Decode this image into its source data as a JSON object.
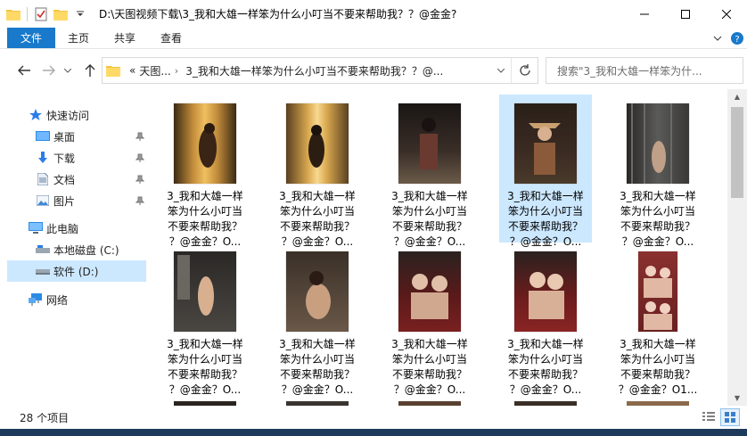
{
  "window": {
    "title": "D:\\天图视频下载\\3_我和大雄一样笨为什么小叮当不要来帮助我？？@金金?",
    "controls": {
      "minimize": "minimize",
      "maximize": "maximize",
      "close": "close"
    }
  },
  "ribbon": {
    "tabs": [
      {
        "label": "文件",
        "active": true
      },
      {
        "label": "主页"
      },
      {
        "label": "共享"
      },
      {
        "label": "查看"
      }
    ]
  },
  "address": {
    "overflow": "«",
    "parts": [
      "天图...",
      "3_我和大雄一样笨为什么小叮当不要来帮助我？？@..."
    ],
    "search_placeholder": "搜索\"3_我和大雄一样笨为什..."
  },
  "nav": {
    "items": [
      {
        "label": "快速访问",
        "icon": "star-icon"
      },
      {
        "label": "桌面",
        "icon": "desktop-icon",
        "pinned": true
      },
      {
        "label": "下载",
        "icon": "download-icon",
        "pinned": true
      },
      {
        "label": "文档",
        "icon": "document-icon",
        "pinned": true
      },
      {
        "label": "图片",
        "icon": "picture-icon",
        "pinned": true
      },
      {
        "label": "此电脑",
        "icon": "computer-icon"
      },
      {
        "label": "本地磁盘 (C:)",
        "icon": "drive-icon"
      },
      {
        "label": "软件 (D:)",
        "icon": "drive-icon",
        "selected": true
      },
      {
        "label": "网络",
        "icon": "network-icon"
      }
    ]
  },
  "files": [
    {
      "label": "3_我和大雄一样\n笨为什么小叮当\n不要来帮助我？\n？@金金？O...",
      "thumb": {
        "bg": "#7a5a2e",
        "fg": "#3a2416"
      }
    },
    {
      "label": "3_我和大雄一样\n笨为什么小叮当\n不要来帮助我？\n？@金金？O...",
      "thumb": {
        "bg": "#a07a3a",
        "fg": "#2b1d12"
      }
    },
    {
      "label": "3_我和大雄一样\n笨为什么小叮当\n不要来帮助我？\n？@金金？O...",
      "thumb": {
        "bg": "#2a2320",
        "fg": "#6a3a30"
      }
    },
    {
      "label": "3_我和大雄一样\n笨为什么小叮当\n不要来帮助我？\n？@金金？O...",
      "thumb": {
        "bg": "#3a2a22",
        "fg": "#8a5a3a"
      },
      "selected": true
    },
    {
      "label": "3_我和大雄一样\n笨为什么小叮当\n不要来帮助我？\n？@金金？O...",
      "thumb": {
        "bg": "#4a4a48",
        "fg": "#2a2826"
      }
    },
    {
      "label": "3_我和大雄一样\n笨为什么小叮当\n不要来帮助我？\n？@金金？O...",
      "thumb": {
        "bg": "#3a3632",
        "fg": "#d8b090"
      }
    },
    {
      "label": "3_我和大雄一样\n笨为什么小叮当\n不要来帮助我？\n？@金金？O...",
      "thumb": {
        "bg": "#5a4a3a",
        "fg": "#c8a080"
      }
    },
    {
      "label": "3_我和大雄一样\n笨为什么小叮当\n不要来帮助我？\n？@金金？O...",
      "thumb": {
        "bg": "#5a1a1a",
        "fg": "#e0c0a8"
      }
    },
    {
      "label": "3_我和大雄一样\n笨为什么小叮当\n不要来帮助我？\n？@金金？O...",
      "thumb": {
        "bg": "#6a1c1c",
        "fg": "#e8c8b0"
      }
    },
    {
      "label": "3_我和大雄一样\n笨为什么小叮当\n不要来帮助我？\n？@金金？O1...",
      "thumb": {
        "bg": "#7a3030",
        "fg": "#f0d0c0"
      }
    }
  ],
  "partial_row": [
    {
      "bg": "#2a2420"
    },
    {
      "bg": "#3a3430"
    },
    {
      "bg": "#5a4030"
    },
    {
      "bg": "#3a2e26"
    },
    {
      "bg": "#8a6a4a"
    }
  ],
  "status": {
    "count": "28 个项目"
  }
}
